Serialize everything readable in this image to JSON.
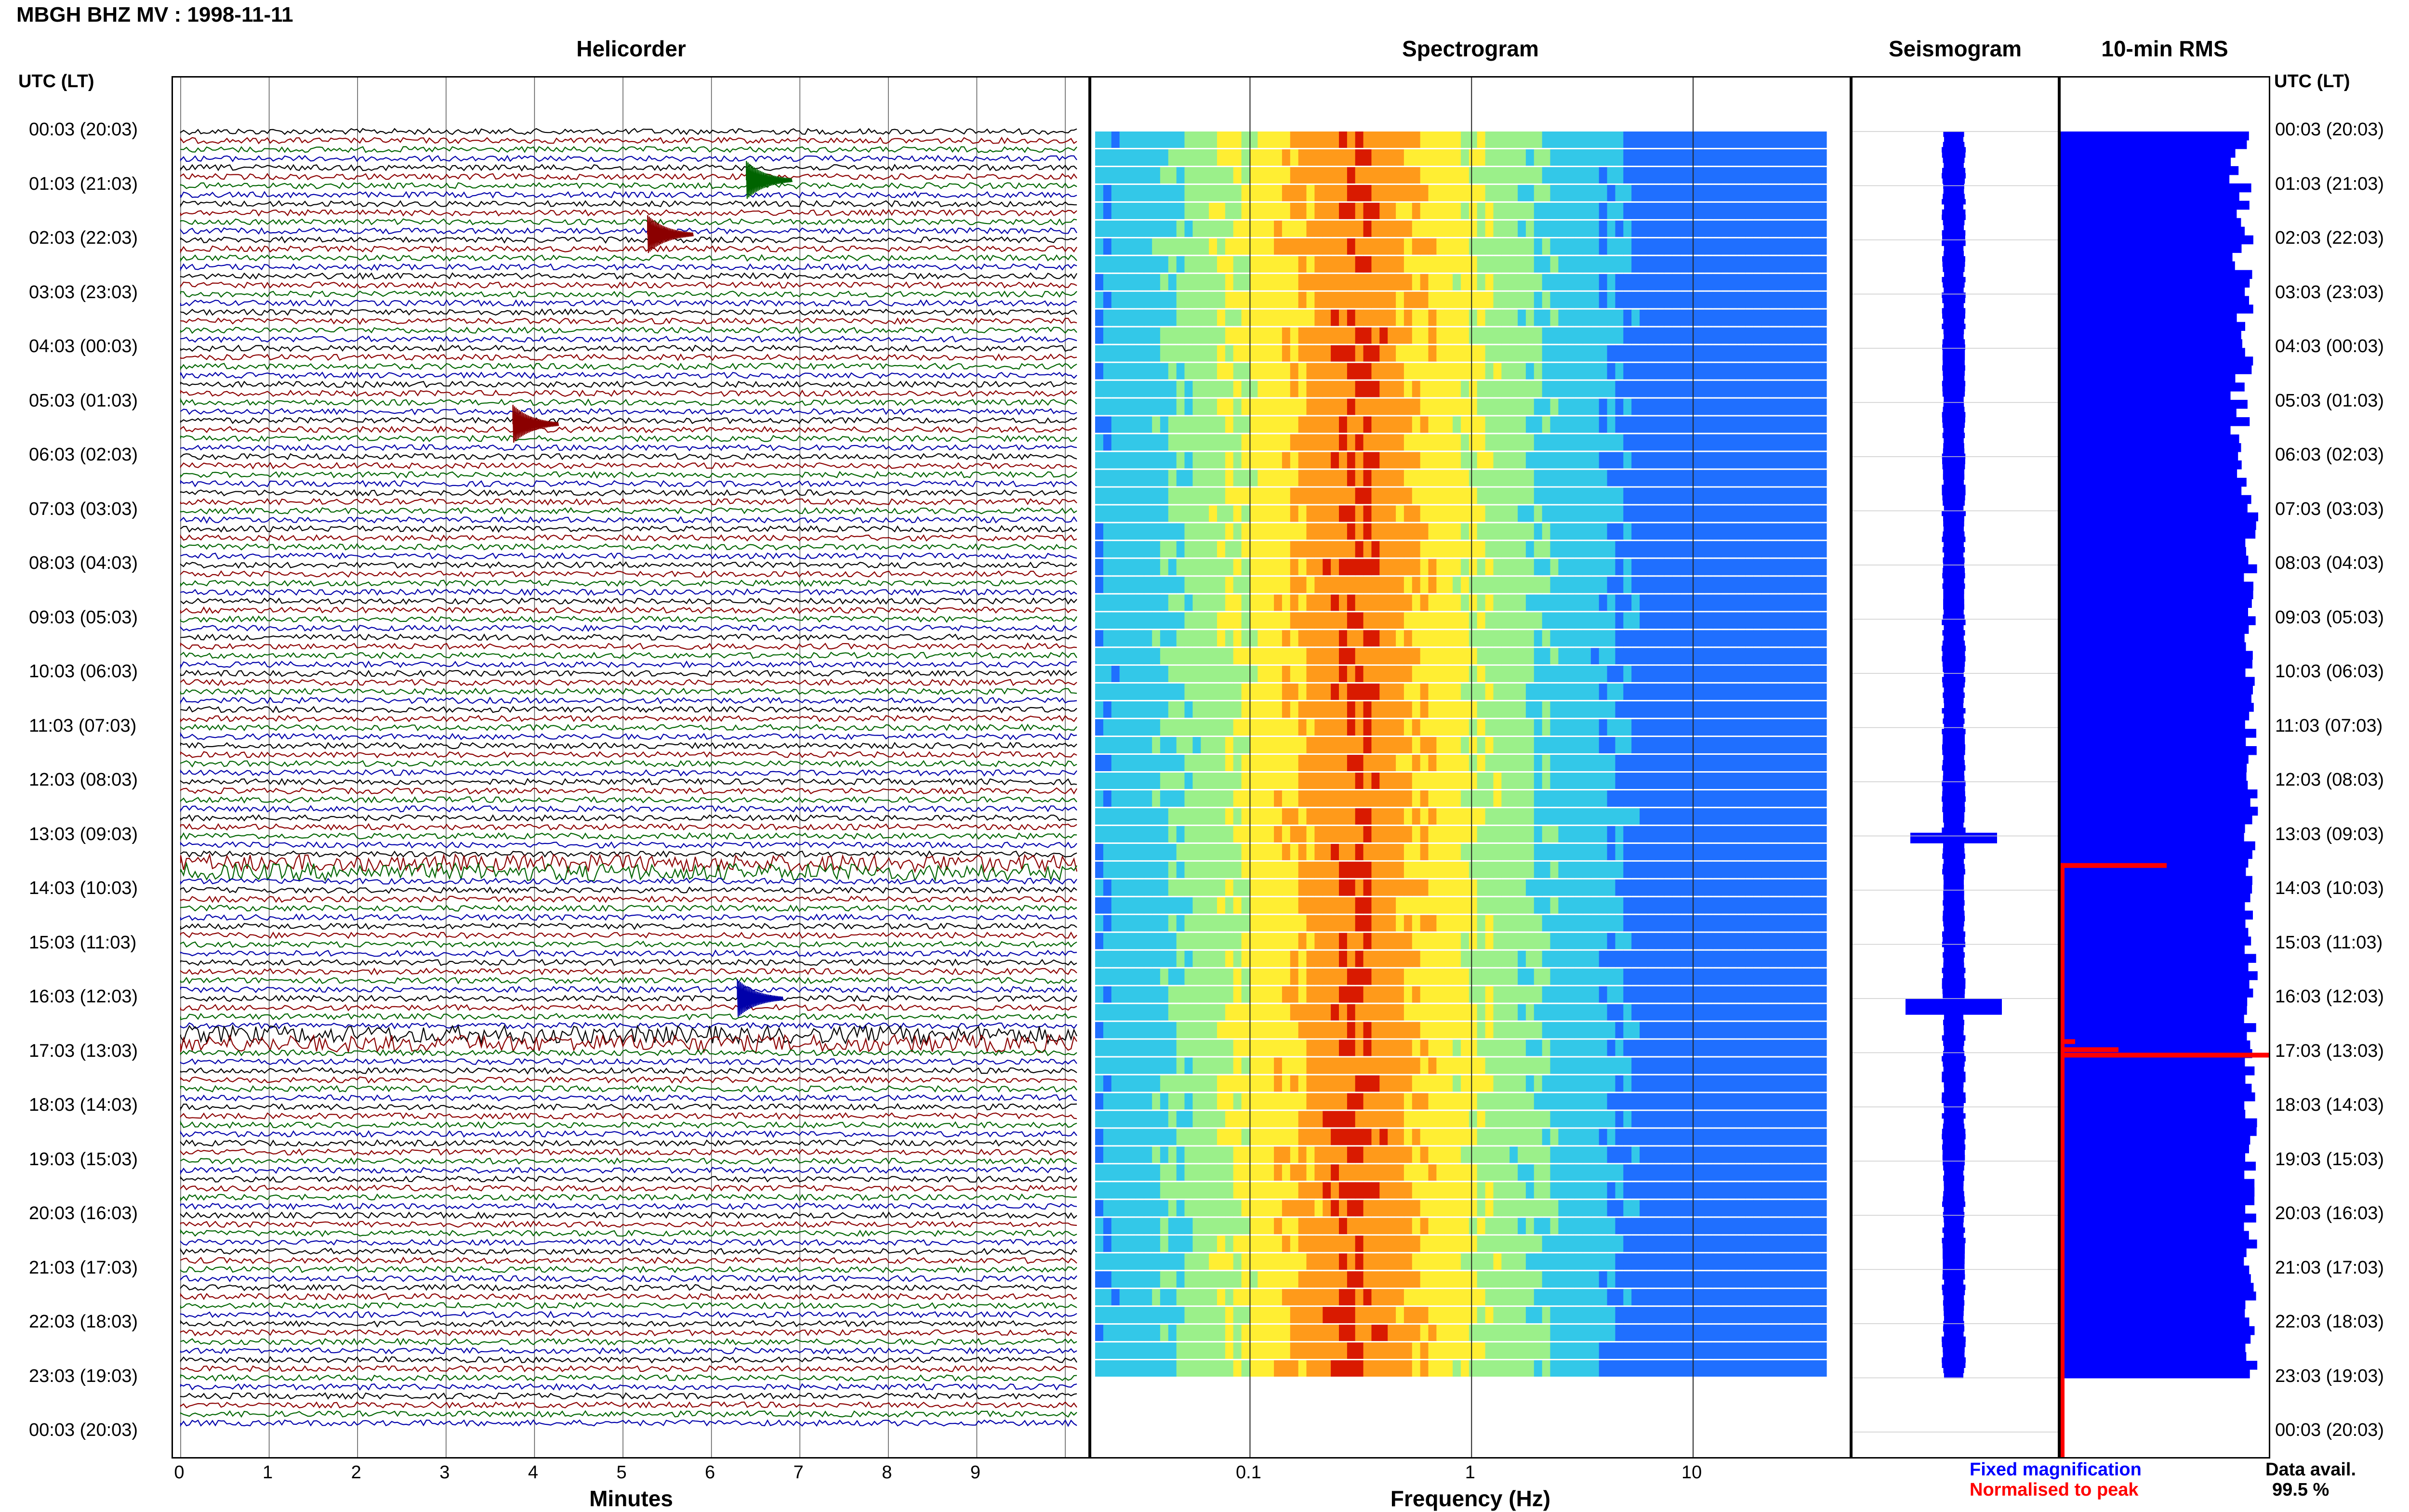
{
  "header": {
    "title": "MBGH BHZ MV : 1998-11-11"
  },
  "panels": {
    "helicorder": "Helicorder",
    "spectrogram": "Spectrogram",
    "seismogram": "Seismogram",
    "rms": "10-min RMS"
  },
  "axis": {
    "utc_left": "UTC (LT)",
    "utc_right": "UTC (LT)",
    "minutes_label": "Minutes",
    "frequency_label": "Frequency (Hz)",
    "minute_ticks": [
      "0",
      "1",
      "2",
      "3",
      "4",
      "5",
      "6",
      "7",
      "8",
      "9"
    ],
    "frequency_ticks": [
      "0.1",
      "1",
      "10"
    ]
  },
  "time_labels": [
    "00:03 (20:03)",
    "01:03 (21:03)",
    "02:03 (22:03)",
    "03:03 (23:03)",
    "04:03 (00:03)",
    "05:03 (01:03)",
    "06:03 (02:03)",
    "07:03 (03:03)",
    "08:03 (04:03)",
    "09:03 (05:03)",
    "10:03 (06:03)",
    "11:03 (07:03)",
    "12:03 (08:03)",
    "13:03 (09:03)",
    "14:03 (10:03)",
    "15:03 (11:03)",
    "16:03 (12:03)",
    "17:03 (13:03)",
    "18:03 (14:03)",
    "19:03 (15:03)",
    "20:03 (16:03)",
    "21:03 (17:03)",
    "22:03 (18:03)",
    "23:03 (19:03)",
    "00:03 (20:03)"
  ],
  "legend": {
    "fixed": "Fixed magnification",
    "normalised": "Normalised to peak",
    "fixed_color": "#0000ff",
    "normalised_color": "#ff0000",
    "data_avail_label": "Data avail.",
    "data_avail_value": "99.5 %"
  },
  "chart_data": {
    "type": "heatmap",
    "hours": 24,
    "helicorder_colors": [
      "#000000",
      "#8b0000",
      "#006400",
      "#0000aa"
    ],
    "minute_range": [
      0,
      10
    ],
    "frequency_range": [
      0.02,
      40
    ],
    "frequency_scale": "log",
    "spectral_peak_hz": 0.3,
    "rms_normalised_rows_hours": [
      13.5,
      16.75,
      16.9,
      17.0
    ]
  }
}
